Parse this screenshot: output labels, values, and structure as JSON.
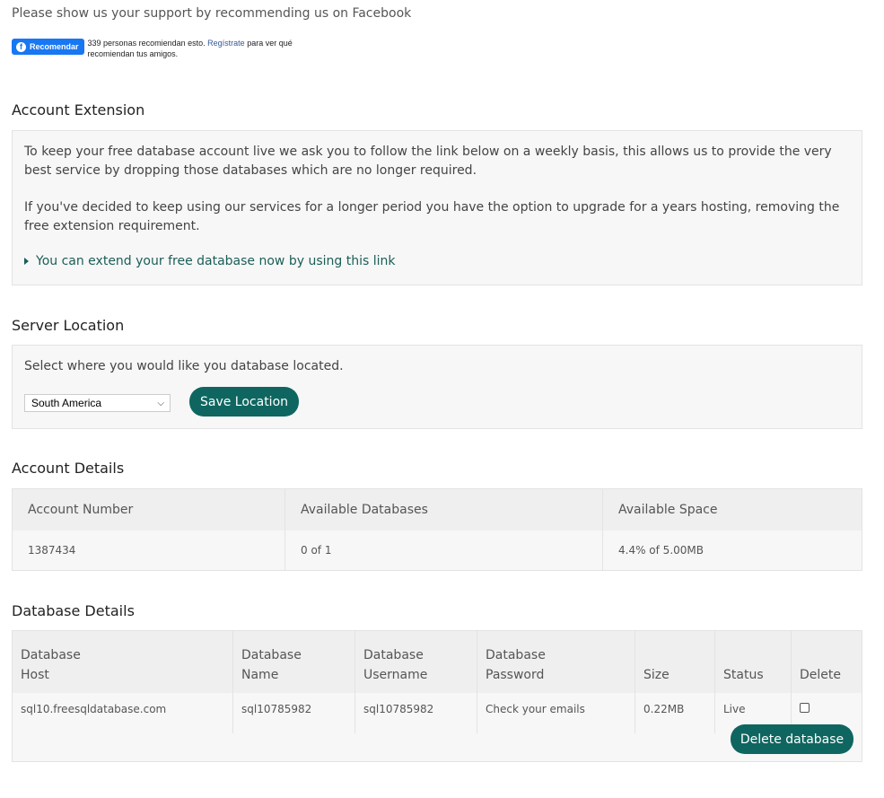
{
  "support": {
    "text": "Please show us your support by recommending us on Facebook",
    "fb_button": "Recomendar",
    "fb_count_text": "339 personas recomiendan esto.",
    "fb_link": "Regístrate",
    "fb_suffix": "para ver qué recomiendan tus amigos."
  },
  "extension": {
    "heading": "Account Extension",
    "para1": "To keep your free database account live we ask you to follow the link below on a weekly basis, this allows us to provide the very best service by dropping those databases which are no longer required.",
    "para2": "If you've decided to keep using our services for a longer period you have the option to upgrade for a years hosting, removing the free extension requirement.",
    "link": "You can extend your free database now by using this link"
  },
  "server": {
    "heading": "Server Location",
    "prompt": "Select where you would like you database located.",
    "selected": "South America",
    "save_label": "Save Location"
  },
  "account": {
    "heading": "Account Details",
    "headers": [
      "Account Number",
      "Available Databases",
      "Available Space"
    ],
    "values": [
      "1387434",
      "0 of 1",
      "4.4% of 5.00MB"
    ]
  },
  "database": {
    "heading": "Database Details",
    "headers": [
      "Database Host",
      "Database Name",
      "Database Username",
      "Database Password",
      "Size",
      "Status",
      "Delete"
    ],
    "row": [
      "sql10.freesqldatabase.com",
      "sql10785982",
      "sql10785982",
      "Check your emails",
      "0.22MB",
      "Live"
    ],
    "delete_label": "Delete database"
  },
  "colors": {
    "accent": "#0f6660",
    "link": "#1b5e57",
    "panel_bg": "#f7f7f7",
    "facebook": "#1877f2"
  }
}
